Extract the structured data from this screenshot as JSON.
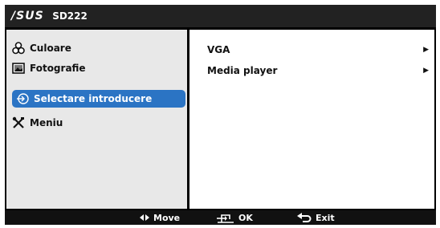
{
  "header": {
    "logo": "/SUS",
    "model": "SD222"
  },
  "sidebar": {
    "items": [
      {
        "label": "Culoare",
        "icon": "color-icon",
        "selected": false
      },
      {
        "label": "Fotografie",
        "icon": "photo-icon",
        "selected": false
      },
      {
        "label": "Selectare introducere",
        "icon": "input-select-icon",
        "selected": true
      },
      {
        "label": "Meniu",
        "icon": "tools-icon",
        "selected": false
      }
    ]
  },
  "submenu": {
    "items": [
      {
        "label": "VGA",
        "arrow": "▶"
      },
      {
        "label": "Media player",
        "arrow": "▶"
      }
    ]
  },
  "footer": {
    "move": "Move",
    "ok": "OK",
    "exit": "Exit"
  },
  "colors": {
    "selected_bg": "#2b74c4",
    "sidebar_bg": "#e8e8e8",
    "header_bg": "#222222",
    "footer_bg": "#111111"
  }
}
